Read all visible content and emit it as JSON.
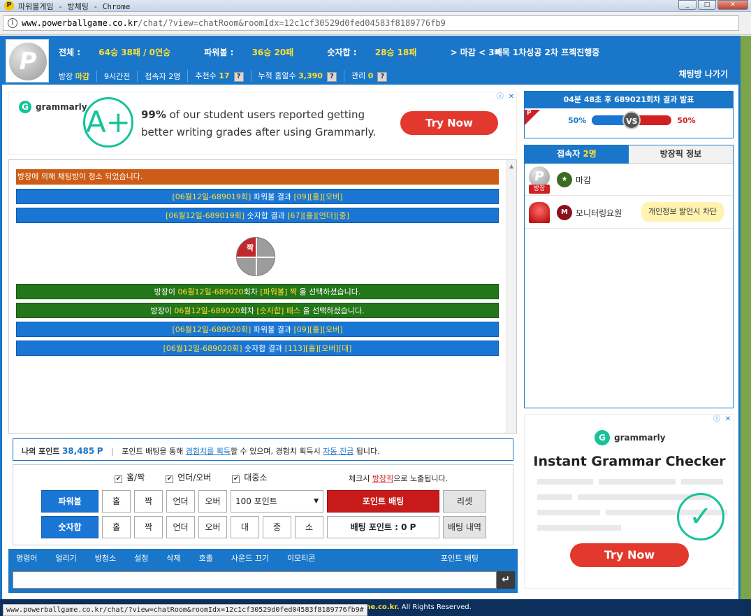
{
  "window": {
    "title": "파워볼게임 - 방채팅 - Chrome",
    "app_icon": "P"
  },
  "address": {
    "domain": "www.powerballgame.co.kr",
    "path": "/chat/?view=chatRoom&roomIdx=12c1cf30529d0fed04583f8189776fb9"
  },
  "header": {
    "logo_letter": "P",
    "total_label": "전체 :",
    "total_value": "64승 38패 / 0연승",
    "powerball_label": "파워볼 :",
    "powerball_value": "36승 20패",
    "sum_label": "숫자합 :",
    "sum_value": "28승 18패",
    "notice": "> 마감 < 3빼목 1차성공 2차 프젝진행중",
    "room_owner_label": "방장",
    "room_owner_value": "마감",
    "hours": "9시간전",
    "users_label": "접속자",
    "users_value": "2명",
    "recommend_label": "추천수",
    "recommend_value": "17",
    "cumulative_label": "누적 홈알수",
    "cumulative_value": "3,390",
    "manage_label": "관리",
    "manage_value": "0",
    "help_glyph": "?",
    "exit_label": "채팅방 나가기"
  },
  "ad_top": {
    "brand": "grammarly",
    "grade": "A+",
    "line1_bold": "99%",
    "line1": " of our student users reported getting",
    "line2": "better writing grades after using Grammarly.",
    "cta": "Try Now",
    "info_glyph": "ⓘ",
    "close_glyph": "✕"
  },
  "chat": {
    "messages": [
      {
        "style": "orange",
        "text": "방장에 의해 채팅방이 청소 되었습니다."
      },
      {
        "style": "blue",
        "pre": "[06월12일-689019회]",
        "mid": " 파워볼 결과 ",
        "res": "[09][홀][오버]"
      },
      {
        "style": "blue",
        "pre": "[06월12일-689019회]",
        "mid": " 숫자합 결과 ",
        "res": "[67][홀][언더][중]"
      },
      {
        "style": "green",
        "a": "방장이 ",
        "b": "06월12일-689020",
        "c": "회차 ",
        "d": "[파워볼] 짝",
        "e": " 을 선택하셨습니다."
      },
      {
        "style": "green",
        "a": "방장이 ",
        "b": "06월12일-689020",
        "c": "회차 ",
        "d": "[숫자합] 패스",
        "e": " 을 선택하셨습니다."
      },
      {
        "style": "blue",
        "pre": "[06월12일-689020회]",
        "mid": " 파워볼 결과 ",
        "res": "[09][홀][오버]"
      },
      {
        "style": "blue",
        "pre": "[06월12일-689020회]",
        "mid": " 숫자합 결과 ",
        "res": "[113][홀][오버][대]"
      }
    ],
    "pie_label": "짝"
  },
  "points": {
    "label": "나의 포인트",
    "value": "38,485",
    "unit": "P",
    "t1": "포인트 배팅을 통해 ",
    "link1": "경험치를 획득",
    "t2": "할 수 있으며, 경험치 획득시 ",
    "link2": "자동 진급",
    "t3": " 됩니다."
  },
  "bet": {
    "checks": [
      "홀/짝",
      "언더/오버",
      "대중소"
    ],
    "check_glyph": "✔",
    "expl_a": "체크시 ",
    "expl_b": "방장픽",
    "expl_c": "으로 노출됩니다.",
    "powerball": "파워볼",
    "sum": "숫자합",
    "odd": "홀",
    "even": "짝",
    "under": "언더",
    "over": "오버",
    "big": "대",
    "mid": "중",
    "small": "소",
    "amount": "100 포인트",
    "amount_arrow": "▼",
    "submit": "포인트 배팅",
    "reset": "리셋",
    "bet_points": "배팅 포인트 : 0 P",
    "history": "배팅 내역"
  },
  "cmdbar": {
    "items": [
      "명령어",
      "얼리기",
      "방청소",
      "설정",
      "삭제",
      "호출",
      "사운드 끄기",
      "이모티콘"
    ],
    "right": "포인트 배팅",
    "enter_glyph": "↵"
  },
  "round": {
    "header": "04분 48초 후 689021회차 결과 발표",
    "flag": "P",
    "left_pct": "50%",
    "right_pct": "50%",
    "left_share": 0.5,
    "vs": "VS"
  },
  "users_panel": {
    "tab_users": "접속자",
    "tab_users_count": "2명",
    "tab_info": "방장픽 정보",
    "users": [
      {
        "avatar": "P",
        "badge": "방장",
        "level": "",
        "name": "마감"
      },
      {
        "avatar": "",
        "badge": "",
        "level": "M",
        "name": "모니터링요원",
        "tip": "개인정보 발언시 차단"
      }
    ]
  },
  "ad_side": {
    "brand": "grammarly",
    "headline": "Instant Grammar Checker",
    "cta": "Try Now",
    "check": "✓",
    "info_glyph": "ⓘ",
    "close_glyph": "✕"
  },
  "status": {
    "url": "www.powerballgame.co.kr/chat/?view=chatRoom&roomIdx=12c1cf30529d0fed04583f8189776fb9#",
    "copy_domain": "me.co.kr.",
    "copy_text": " All Rights Reserved."
  },
  "colors": {
    "brand_blue": "#1a76c8",
    "accent_yellow": "#ffe033",
    "red": "#d12020",
    "green": "#24761a",
    "grammarly": "#15c39a"
  }
}
